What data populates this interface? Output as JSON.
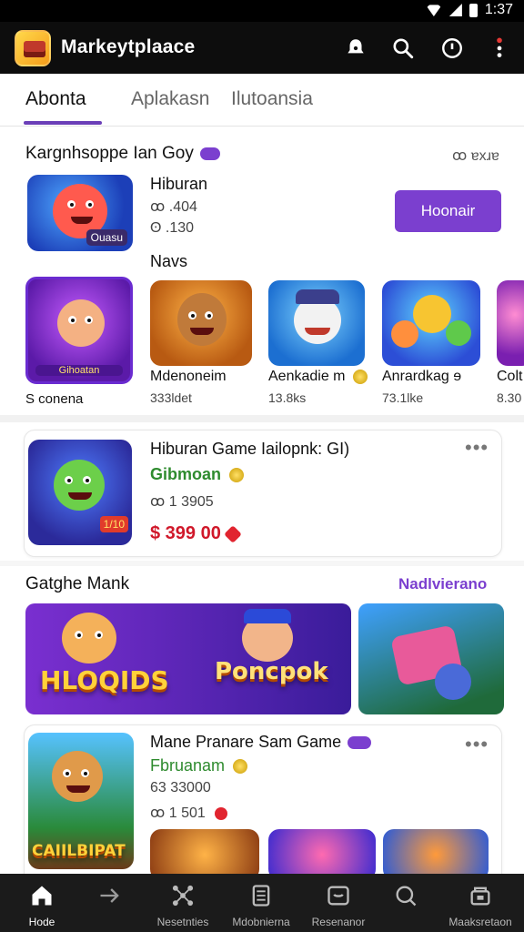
{
  "status_bar": {
    "time": "1:37"
  },
  "app_bar": {
    "title": "Markeytplaace"
  },
  "tabs": [
    {
      "label": "Abonta"
    },
    {
      "label": "Aplakasn"
    },
    {
      "label": "Ilutoansia"
    }
  ],
  "section1": {
    "title": "Kargnhsoppe Ian Goy",
    "action": "ꝏ ɐxɹɐ",
    "featured": {
      "name": "Hiburan",
      "meta1": "ꝏ .404",
      "meta2": "ʘ .130",
      "thumb_badge": "Ouasu",
      "install_label": "Hoonair"
    },
    "row_title": "Navs",
    "row_items": [
      {
        "label": "Gihoatan",
        "meta": "S conena"
      },
      {
        "label": "Mdenoneim",
        "meta": "333ldet"
      },
      {
        "label": "Aenkadie m",
        "meta": "13.8ks"
      },
      {
        "label": "Anrardkag",
        "meta": "73.1lke",
        "suffix": "ɘ"
      },
      {
        "label": "Colt",
        "meta": "8.30"
      }
    ]
  },
  "card1": {
    "title": "Hiburan Game Iailopnk: GI)",
    "subtitle": "Gibmoan",
    "meta": "ꝏ 1 3905",
    "price": "$ 399 00",
    "badge": "1/10"
  },
  "section2": {
    "title": "Gatghe Mank",
    "action": "Nadlvierano",
    "banners": [
      {
        "text": "HLOQIDS"
      },
      {
        "text": "Poncpok"
      },
      {
        "text": ""
      }
    ]
  },
  "card2": {
    "title": "Mane Pranare Sam Game",
    "subtitle": "Fbruanam",
    "meta1": "63 33000",
    "meta2": "ꝏ 1 501",
    "thumb_text": "CAIILBIPAT"
  },
  "bottom_nav": [
    {
      "label": "Hode",
      "icon": "home-icon"
    },
    {
      "label": "",
      "icon": "arrow-right-icon"
    },
    {
      "label": "Nesetnties",
      "icon": "network-icon"
    },
    {
      "label": "Mdobnierna",
      "icon": "document-icon"
    },
    {
      "label": "Resenanor",
      "icon": "smile-box-icon"
    },
    {
      "label": "",
      "icon": "search-icon"
    },
    {
      "label": "Maaksretaon",
      "icon": "store-icon"
    }
  ],
  "colors": {
    "accent": "#7b3fcf",
    "price": "#d0182a",
    "app_bar": "#0d0d0d",
    "nav": "#1b1b1b"
  }
}
